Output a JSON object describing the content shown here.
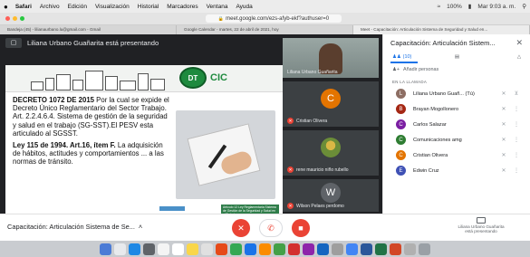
{
  "menubar": {
    "apple": "",
    "items": [
      "Safari",
      "Archivo",
      "Edición",
      "Visualización",
      "Historial",
      "Marcadores",
      "Ventana",
      "Ayuda"
    ],
    "clock": "Mar 9:03 a. m.",
    "battery": "100%"
  },
  "browser": {
    "url": "meet.google.com/ezs-afyb-ekf?authuser=0",
    "tabs": [
      "Bandeja (45) - lilianaurbano.lu@gmail.com - Gmail",
      "Google Calendar - martes, 22 de abril de 2021, hoy",
      "Meet - Capacitación: Articulación Sistema de Seguridad y Salud en..."
    ]
  },
  "stage": {
    "presenting_label": "Liliana Urbano Guañarita está presentando"
  },
  "slide": {
    "logo_text": "CIC",
    "logo_badge": "DT",
    "para1_bold": "DECRETO 1072 DE 2015",
    "para1_rest": " Por la cual se expide el Decreto Único Reglamentario del Sector Trabajo. Art. 2.2.4.6.4. Sistema de gestión de la seguridad y salud en el trabajo (SG-SST).El PESV esta articulado al SGSST.",
    "para2_bold": "Ley 115 de 1994. Art.16, ítem F.",
    "para2_rest": " La adquisición de hábitos, actitudes y comportamientos ... a las normas de tránsito.",
    "caption": "Artículo 12 Ley Reglamentaria Sistema de Gestión de la Seguridad y Salud en el Trabajo"
  },
  "tiles": [
    {
      "name": "Liliana Urbano Guañarita",
      "type": "video"
    },
    {
      "name": "Cristian Olivera",
      "initial": "C",
      "color": "#e37400"
    },
    {
      "name": "rene mauricio niño rubello",
      "type": "image"
    },
    {
      "name": "Wilson Pelaes perdomo",
      "initial": "W",
      "color": "#5f6368"
    }
  ],
  "bottombar": {
    "meeting_name": "Capacitación: Articulación Sistema de Se...",
    "present_status_line1": "Liliana Urbano Guañarita",
    "present_status_line2": "está presentando"
  },
  "panel": {
    "title": "Capacitación: Articulación Sistem...",
    "people_tab_count": "(10)",
    "add_people": "Añadir personas",
    "section_label": "EN LA LLAMADA",
    "participants": [
      {
        "name": "Liliana Urbano Guañ...",
        "suffix": "(Tú)",
        "initial": "L",
        "color": "#8d6e63"
      },
      {
        "name": "Brayan Mogollonero",
        "initial": "B",
        "color": "#a52714"
      },
      {
        "name": "Carlos Salazar",
        "initial": "C",
        "color": "#7b1fa2"
      },
      {
        "name": "Comunicaciones amg",
        "initial": "C",
        "color": "#2e7d32"
      },
      {
        "name": "Cristian Olivera",
        "initial": "C",
        "color": "#e37400"
      },
      {
        "name": "Edwin Cruz",
        "initial": "E",
        "color": "#3f51b5"
      }
    ]
  },
  "colors": {
    "accent": "#1a73e8",
    "danger": "#ea4335",
    "stage_bg": "#202124"
  }
}
